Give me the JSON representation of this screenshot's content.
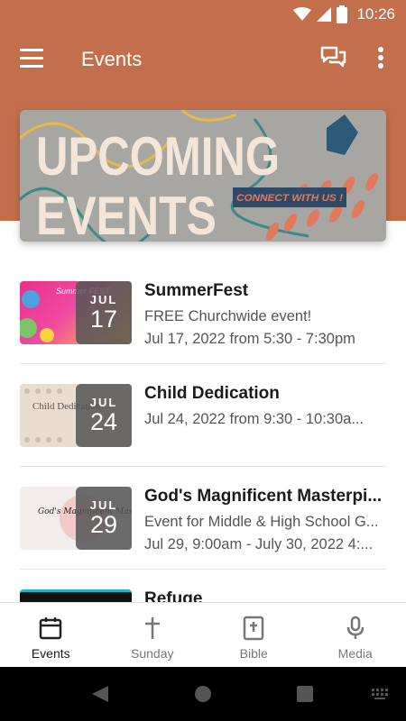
{
  "status_bar": {
    "time": "10:26"
  },
  "app_bar": {
    "title": "Events"
  },
  "banner": {
    "line1": "UPCOMING",
    "line2": "EVENTS",
    "tagline": "CONNECT WITH US !"
  },
  "events": [
    {
      "title": "SummerFest",
      "subtitle": "FREE Churchwide event!",
      "date": "Jul 17, 2022 from 5:30 - 7:30pm",
      "month": "JUL",
      "day": "17",
      "thumb_text": "Summer FEST"
    },
    {
      "title": "Child Dedication",
      "subtitle": "Jul 24, 2022 from 9:30 - 10:30a...",
      "date": "",
      "month": "JUL",
      "day": "24",
      "thumb_text": "Child Dedication"
    },
    {
      "title": "God's Magnificent Masterpi...",
      "subtitle": "Event for Middle & High School G...",
      "date": "Jul 29, 9:00am - July 30, 2022 4:...",
      "month": "JUL",
      "day": "29",
      "thumb_text": "God's Magnificent Masterpiece"
    },
    {
      "title": "Refuge",
      "subtitle": "",
      "date": "",
      "month": "",
      "day": "",
      "thumb_text": ""
    }
  ],
  "bottom_nav": [
    {
      "label": "Events",
      "icon": "calendar-icon",
      "active": true
    },
    {
      "label": "Sunday",
      "icon": "cross-icon",
      "active": false
    },
    {
      "label": "Bible",
      "icon": "bible-icon",
      "active": false
    },
    {
      "label": "Media",
      "icon": "microphone-icon",
      "active": false
    }
  ],
  "colors": {
    "accent": "#c46f4c",
    "badge": "#555555"
  }
}
